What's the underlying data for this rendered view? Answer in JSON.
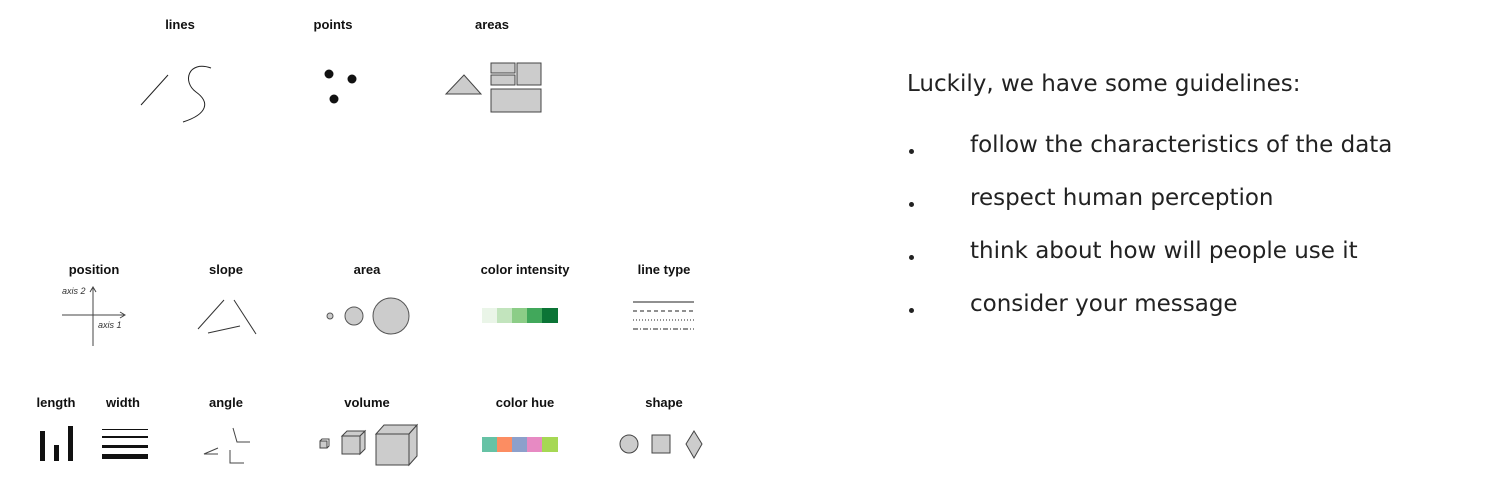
{
  "marks": {
    "lines": "lines",
    "points": "points",
    "areas": "areas"
  },
  "channels": {
    "position": "position",
    "axis1": "axis 1",
    "axis2": "axis 2",
    "slope": "slope",
    "area": "area",
    "color_intensity": "color intensity",
    "line_type": "line type",
    "length": "length",
    "width": "width",
    "angle": "angle",
    "volume": "volume",
    "color_hue": "color hue",
    "shape": "shape"
  },
  "colors": {
    "intensity": [
      "#eaf5e8",
      "#c2e4bd",
      "#8ccd87",
      "#41a85b",
      "#0b7436"
    ],
    "hue": [
      "#66c2a5",
      "#fc8d62",
      "#8da0cb",
      "#e78ac3",
      "#a6d854"
    ],
    "fill_gray": "#cccccc"
  },
  "guidelines": {
    "intro": "Luckily, we have some guidelines:",
    "items": [
      "follow the characteristics of the data",
      "respect human perception",
      "think about how will people use it",
      "consider your message"
    ]
  }
}
